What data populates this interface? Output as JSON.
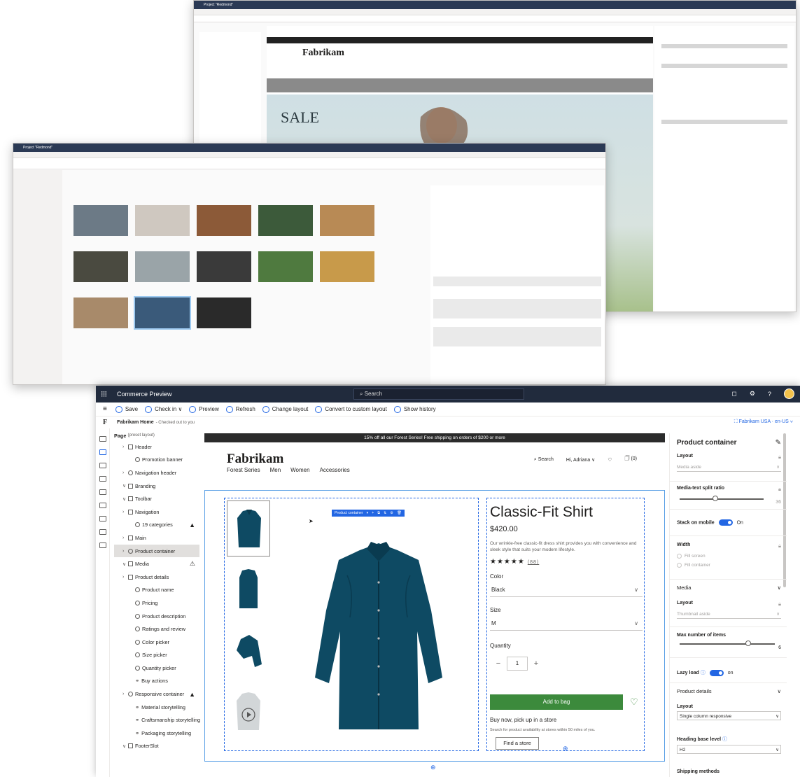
{
  "back_window_1": {
    "title": "Project \"Redmond\""
  },
  "back_window_2": {
    "title": "Project \"Redmond\""
  },
  "topbar": {
    "app_title": "Commerce Preview",
    "search_placeholder": "Search"
  },
  "commandbar": {
    "items": [
      "Save",
      "Check in",
      "Preview",
      "Refresh",
      "Change layout",
      "Convert to custom layout",
      "Show history"
    ],
    "checkin_suffix": "∨"
  },
  "breadcrumb": {
    "title": "Fabrikam Home",
    "status": "- Checked out to you",
    "locale": "Fabrikam USA · en-US"
  },
  "tree": {
    "page_label": "Page",
    "page_sub": "(preset layout)",
    "items": [
      {
        "label": "Header",
        "indent": 0,
        "chev": "›",
        "type": "box"
      },
      {
        "label": "Promotion banner",
        "indent": 1,
        "chev": "",
        "type": "cir"
      },
      {
        "label": "Navigation header",
        "indent": 0,
        "chev": "›",
        "type": "cir"
      },
      {
        "label": "Branding",
        "indent": 0,
        "chev": "∨",
        "type": "box"
      },
      {
        "label": "Toolbar",
        "indent": 0,
        "chev": "∨",
        "type": "box"
      },
      {
        "label": "Navigation",
        "indent": 0,
        "chev": "›",
        "type": "box"
      },
      {
        "label": "19 categories",
        "indent": 1,
        "chev": "",
        "type": "cir",
        "warn": "▲"
      },
      {
        "label": "Main",
        "indent": 0,
        "chev": "›",
        "type": "box"
      },
      {
        "label": "Product container",
        "indent": 0,
        "chev": "›",
        "type": "cir",
        "selected": true
      },
      {
        "label": "Media",
        "indent": 0,
        "chev": "∨",
        "type": "box",
        "warn": "⚠"
      },
      {
        "label": "Product details",
        "indent": 0,
        "chev": "›",
        "type": "box"
      },
      {
        "label": "Product name",
        "indent": 1,
        "chev": "",
        "type": "cir"
      },
      {
        "label": "Pricing",
        "indent": 1,
        "chev": "",
        "type": "cir"
      },
      {
        "label": "Product description",
        "indent": 1,
        "chev": "",
        "type": "cir"
      },
      {
        "label": "Ratings and review",
        "indent": 1,
        "chev": "",
        "type": "cir"
      },
      {
        "label": "Color picker",
        "indent": 1,
        "chev": "",
        "type": "cir"
      },
      {
        "label": "Size picker",
        "indent": 1,
        "chev": "",
        "type": "cir"
      },
      {
        "label": "Quantity picker",
        "indent": 1,
        "chev": "",
        "type": "cir"
      },
      {
        "label": "Buy actions",
        "indent": 1,
        "chev": "",
        "type": "ico"
      },
      {
        "label": "Responsive container",
        "indent": 0,
        "chev": "›",
        "type": "cir",
        "warn": "▲"
      },
      {
        "label": "Material storytelling",
        "indent": 1,
        "chev": "",
        "type": "ico"
      },
      {
        "label": "Craftsmanship storytelling",
        "indent": 1,
        "chev": "",
        "type": "ico"
      },
      {
        "label": "Packaging storytelling",
        "indent": 1,
        "chev": "",
        "type": "ico"
      },
      {
        "label": "FooterSlot",
        "indent": 0,
        "chev": "∨",
        "type": "box"
      }
    ]
  },
  "site": {
    "promo": "15% off all our Forest Series! Free shipping on orders of $200 or more",
    "logo": "Fabrikam",
    "header_links": [
      "Search",
      "Hi, Adriana ∨",
      "♡",
      "(0)"
    ],
    "menu": [
      "Forest Series",
      "Men",
      "Women",
      "Accessories"
    ]
  },
  "product": {
    "control_label": "Product container",
    "title": "Classic-Fit Shirt",
    "price": "$420.00",
    "description": "Our wrinkle-free classic-fit dress shirt provides you with convenience and sleek style that suits your modern lifestyle.",
    "stars": "★★★★★",
    "review_count": "(88)",
    "color_label": "Color",
    "color_value": "Black",
    "size_label": "Size",
    "size_value": "M",
    "quantity_label": "Quantity",
    "quantity_value": "1",
    "add_to_bag": "Add to bag",
    "buy_now": "Buy now, pick up in a store",
    "buy_sub": "Search for product availability at stores within 50 miles of you.",
    "find_store": "Find a store"
  },
  "panel": {
    "title": "Product container",
    "layout_label": "Layout",
    "layout_value": "Media aside",
    "split_label": "Media-text split ratio",
    "split_value": "36",
    "stack_label": "Stack on mobile",
    "stack_value": "On",
    "width_label": "Width",
    "width_opt1": "Fill screen",
    "width_opt2": "Fill container",
    "media_head": "Media",
    "media_layout_label": "Layout",
    "media_layout_value": "Thumbnail aside",
    "max_label": "Max number of items",
    "max_value": "6",
    "lazy_label": "Lazy load",
    "lazy_value": "on",
    "details_head": "Product details",
    "details_layout_label": "Layout",
    "details_layout_value": "Single column responsive",
    "heading_label": "Heading base level",
    "heading_value": "H2",
    "shipping_label": "Shipping methods"
  },
  "colors": {
    "accent": "#2266e3",
    "topbar": "#212b3d",
    "shirt": "#0e4a63",
    "buy": "#3c8a3c"
  }
}
